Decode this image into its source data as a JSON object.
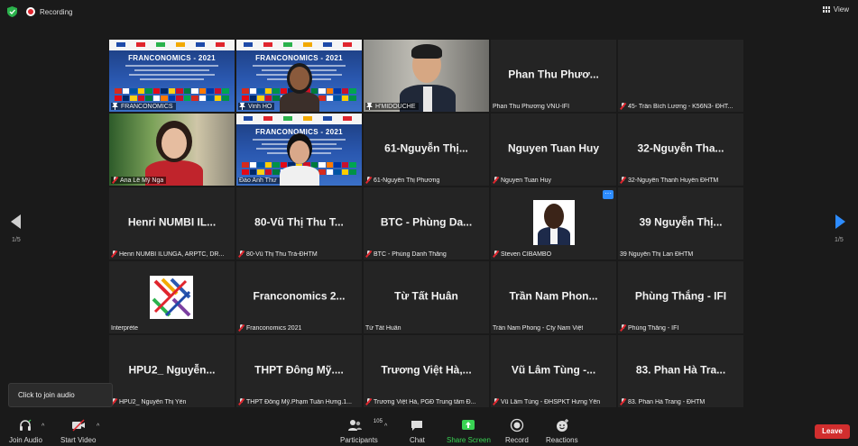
{
  "topbar": {
    "recording_label": "Recording",
    "view_label": "View"
  },
  "tiles": [
    {
      "type": "slide",
      "slide_title": "FRANCONOMICS - 2021",
      "caption": "FRANCONOMICS",
      "pinned": true
    },
    {
      "type": "slide-person",
      "slide_title": "FRANCONOMICS - 2021",
      "caption": "Vinh HO",
      "muted": false,
      "pinned": true
    },
    {
      "type": "person-suit",
      "caption": "H'MIDOUCHE",
      "pinned": true,
      "speaking": true
    },
    {
      "type": "name",
      "name": "Phan Thu Phươ...",
      "caption": "Phan Thu Phương VNU-IFI",
      "muted": false
    },
    {
      "type": "name",
      "name": "",
      "caption": "45- Trần Bích Lương - K56N3- ĐHT...",
      "muted": true
    },
    {
      "type": "person-woman",
      "caption": "Ana Lê Mỹ Nga",
      "muted": true
    },
    {
      "type": "slide-person2",
      "slide_title": "FRANCONOMICS - 2021",
      "caption": "Đào Anh Thư",
      "muted": false
    },
    {
      "type": "name",
      "name": "61-Nguyễn Thị...",
      "caption": "61-Nguyễn Thị Phương",
      "muted": true
    },
    {
      "type": "name",
      "name": "Nguyen Tuan Huy",
      "caption": "Nguyen Tuan Huy",
      "muted": true
    },
    {
      "type": "name",
      "name": "32-Nguyễn Tha...",
      "caption": "32-Nguyễn Thanh Huyền ĐHTM",
      "muted": true
    },
    {
      "type": "name",
      "name": "Henri NUMBI IL...",
      "caption": "Henri NUMBI ILUNGA, ARPTC, DR...",
      "muted": true
    },
    {
      "type": "name",
      "name": "80-Vũ Thị Thu T...",
      "caption": "80-Vũ Thị Thu Trà-ĐHTM",
      "muted": true
    },
    {
      "type": "name",
      "name": "BTC - Phùng Da...",
      "caption": "BTC - Phùng Danh Thắng",
      "muted": true
    },
    {
      "type": "avatar",
      "caption": "Steven CIBAMBO",
      "muted": true,
      "more": "···"
    },
    {
      "type": "name",
      "name": "39 Nguyễn Thị...",
      "caption": "39 Nguyễn Thị Lan ĐHTM",
      "muted": false
    },
    {
      "type": "logo",
      "caption": "Interprète",
      "muted": false
    },
    {
      "type": "name",
      "name": "Franconomics 2...",
      "caption": "Franconomics 2021",
      "muted": true
    },
    {
      "type": "name",
      "name": "Từ Tất Huân",
      "caption": "Từ Tất Huân",
      "muted": false
    },
    {
      "type": "name",
      "name": "Trần Nam Phon...",
      "caption": "Trần Nam Phong - Cty Nam Việt",
      "muted": false
    },
    {
      "type": "name",
      "name": "Phùng Thắng - IFI",
      "caption": "Phùng Thắng - IFI",
      "muted": true
    },
    {
      "type": "name",
      "name": "HPU2_ Nguyễn...",
      "caption": "HPU2_ Nguyễn Thị Yến",
      "muted": true
    },
    {
      "type": "name",
      "name": "THPT Đông Mỹ....",
      "caption": "THPT Đông Mỹ.Phạm Tuấn Hưng.1...",
      "muted": true
    },
    {
      "type": "name",
      "name": "Trương Việt Hà,...",
      "caption": "Trương Việt Hà, PGĐ Trung tâm Đ...",
      "muted": true
    },
    {
      "type": "name",
      "name": "Vũ Lâm Tùng -...",
      "caption": "Vũ Lâm Tùng - ĐHSPKT Hưng Yên",
      "muted": true
    },
    {
      "type": "name",
      "name": "83. Phan Hà Tra...",
      "caption": "83. Phan Hà Trang - ĐHTM",
      "muted": true
    }
  ],
  "pagination": {
    "left": "1/5",
    "right": "1/5"
  },
  "tooltip": "Click to join audio",
  "toolbar": {
    "join_audio": "Join Audio",
    "start_video": "Start Video",
    "participants": "Participants",
    "participant_count": "105",
    "chat": "Chat",
    "share_screen": "Share Screen",
    "record": "Record",
    "reactions": "Reactions",
    "leave": "Leave"
  },
  "colors": {
    "accent": "#2d8cff",
    "share": "#39d353",
    "leave": "#d12e2e",
    "speaking": "#e4e94a"
  }
}
